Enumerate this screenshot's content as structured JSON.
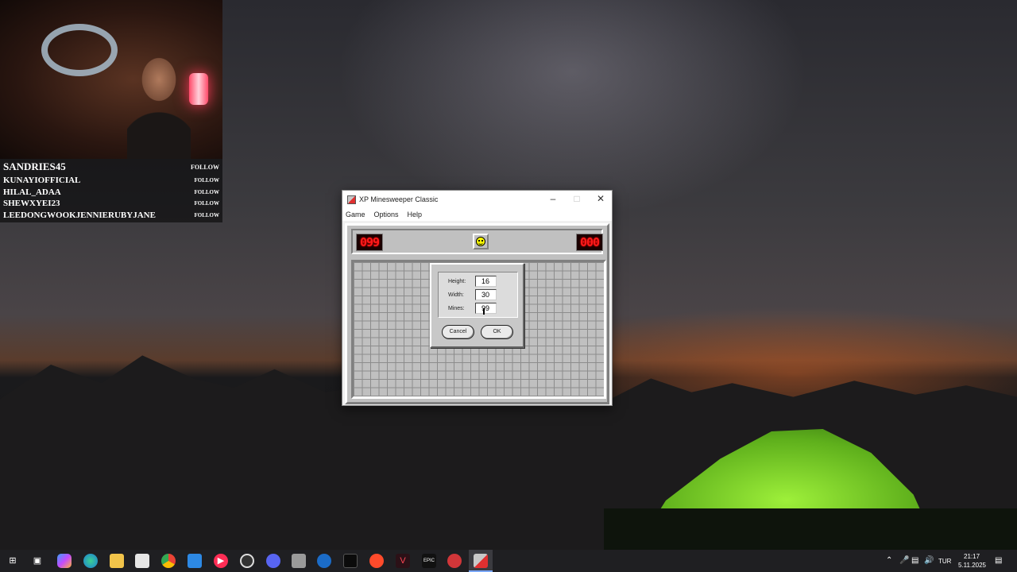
{
  "stream": {
    "channel_name": "SANDRIES45",
    "follow_label": "FOLLOW",
    "recent_followers": [
      {
        "name": "KUNAYIOFFICIAL",
        "label": "FOLLOW"
      },
      {
        "name": "HILAL_ADAA",
        "label": "FOLLOW"
      },
      {
        "name": "SHEWXYEI23",
        "label": "FOLLOW"
      },
      {
        "name": "LEEDONGWOOKJENNIERUBYJANE",
        "label": "FOLLOW"
      }
    ]
  },
  "window": {
    "title": "XP Minesweeper Classic",
    "minimize_icon": "minimize-icon",
    "maximize_icon": "maximize-icon",
    "close_icon": "close-icon",
    "menu": [
      "Game",
      "Options",
      "Help"
    ]
  },
  "game": {
    "mine_counter": "099",
    "timer": "000",
    "face": "smiley-face",
    "grid_rows": 16,
    "grid_cols": 30
  },
  "custom_dialog": {
    "height_label": "Height:",
    "height_value": "16",
    "width_label": "Width:",
    "width_value": "30",
    "mines_label": "Mines:",
    "mines_value": "99",
    "cancel_label": "Cancel",
    "ok_label": "OK"
  },
  "taskbar": {
    "pinned_icons": [
      "windows-start-icon",
      "task-view-icon",
      "copilot-icon",
      "edge-icon",
      "file-explorer-icon",
      "store-icon",
      "chrome-icon",
      "mail-icon",
      "media-player-icon",
      "obs-icon",
      "discord-icon",
      "steelseries-icon",
      "steam-icon",
      "terminal-icon",
      "ea-icon",
      "valorant-icon",
      "epic-games-icon",
      "riot-client-icon",
      "minesweeper-icon"
    ],
    "language": "TUR",
    "time": "21:17",
    "date": "5.11.2025"
  },
  "colors": {
    "lcd_red": "#ff1a1a",
    "classic_gray": "#c0c0c0",
    "taskbar_bg": "#1f1f22"
  }
}
